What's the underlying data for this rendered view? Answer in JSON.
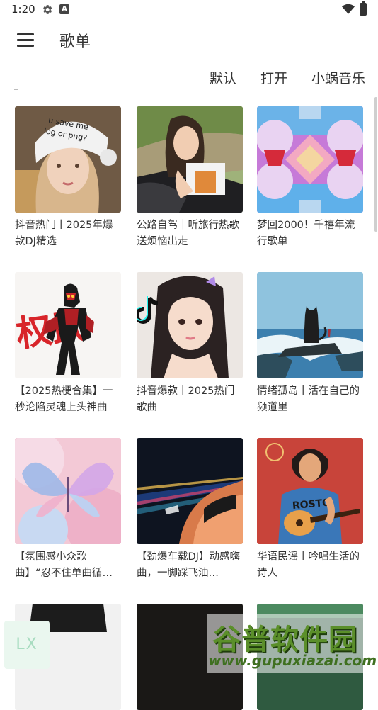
{
  "status_bar": {
    "time": "1:20",
    "icons": [
      "gear-icon",
      "a-icon",
      "wifi-icon",
      "battery-icon"
    ]
  },
  "app_bar": {
    "title": "歌单",
    "menu_icon": "hamburger-menu-icon"
  },
  "tabs": [
    {
      "label": "默认"
    },
    {
      "label": "打开"
    },
    {
      "label": "小蜗音乐"
    }
  ],
  "playlists": [
    {
      "title": "抖音热门丨2025年爆款DJ精选"
    },
    {
      "title": "公路自驾｜听旅行热歌送烦恼出走"
    },
    {
      "title": "梦回2000！千禧年流行歌单"
    },
    {
      "title": "【2025热梗合集】一秒沦陷灵魂上头神曲"
    },
    {
      "title": "抖音爆款丨2025热门歌曲"
    },
    {
      "title": "情绪孤岛丨活在自己的频道里"
    },
    {
      "title": "【氛围感小众歌曲】“忍不住单曲循…"
    },
    {
      "title": "【劲爆车载DJ】动感嗨曲，一脚踩飞油…"
    },
    {
      "title": "华语民谣丨吟唱生活的诗人"
    },
    {
      "title": ""
    },
    {
      "title": ""
    },
    {
      "title": ""
    }
  ],
  "cover_texts": {
    "cap_text": "u save me\nlog or png?",
    "graffiti": "权武",
    "shirt_text": "ROSTO"
  },
  "floating_logo": "LX",
  "watermark": {
    "brand": "谷普软件园",
    "url": "www.gupuxiazai.com"
  }
}
